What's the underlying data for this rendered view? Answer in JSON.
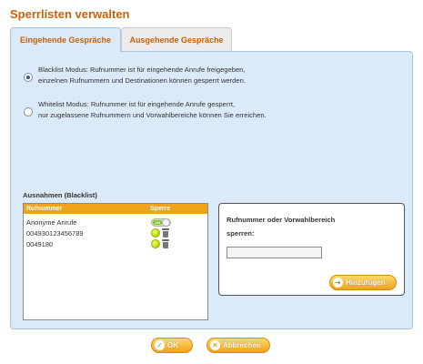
{
  "page": {
    "title": "Sperrlisten verwalten"
  },
  "tabs": [
    {
      "label": "Eingehende Gespräche",
      "active": true
    },
    {
      "label": "Ausgehende Gespräche",
      "active": false
    }
  ],
  "modes": [
    {
      "checked": true,
      "line1": "Blacklist Modus: Rufnummer ist für eingehende Anrufe freigegeben,",
      "line2": "einzelnen Rufnummern und Destinationen können gesperrt werden."
    },
    {
      "checked": false,
      "line1": "Whitelist Modus: Rufnummer ist für eingehende Anrufe gesperrt,",
      "line2": "nur zugelassene Rufnummern und Vorwahlbereiche können Sie erreichen."
    }
  ],
  "exceptions": {
    "label": "Ausnahmen (Blacklist)",
    "columns": {
      "number": "Rufnummer",
      "block": "Sperre"
    },
    "rows": [
      {
        "number": "Anonyme Anrufe",
        "control": "toggle",
        "toggle_label": "ON"
      },
      {
        "number": "004930123456789",
        "control": "dot-trash"
      },
      {
        "number": "0049180",
        "control": "dot-trash"
      }
    ]
  },
  "add_panel": {
    "label_line1": "Rufnummer oder Vorwahlbereich",
    "label_line2": "sperren:",
    "input_value": "",
    "button_label": "Hinzufügen"
  },
  "footer": {
    "ok_label": "OK",
    "cancel_label": "Abbrechen"
  },
  "colors": {
    "accent": "#c8620a",
    "panel_bg": "#dbeaf8",
    "table_header": "#f0a319",
    "button": "#f0a319"
  }
}
